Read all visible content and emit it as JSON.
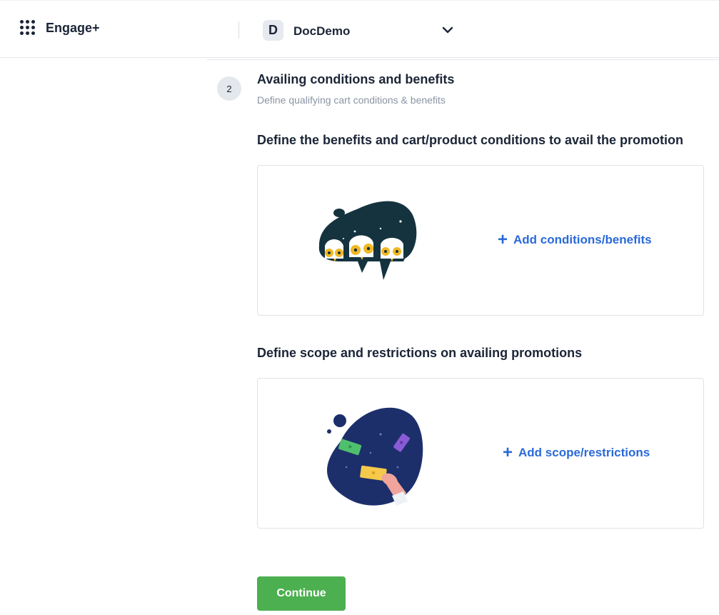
{
  "header": {
    "brand": "Engage+",
    "org_initial": "D",
    "org_name": "DocDemo"
  },
  "step": {
    "number": "2",
    "title": "Availing conditions and benefits",
    "subtitle": "Define qualifying cart conditions & benefits"
  },
  "sections": [
    {
      "heading": "Define the benefits and cart/product conditions to avail the promotion",
      "action_label": "Add conditions/benefits",
      "illustration": "owls-illustration"
    },
    {
      "heading": "Define scope and restrictions on availing promotions",
      "action_label": "Add scope/restrictions",
      "illustration": "tickets-illustration"
    }
  ],
  "continue_label": "Continue",
  "colors": {
    "accent_link": "#2a6ad8",
    "primary_button": "#4caf50",
    "text": "#1b2536",
    "muted": "#8b94a3"
  }
}
